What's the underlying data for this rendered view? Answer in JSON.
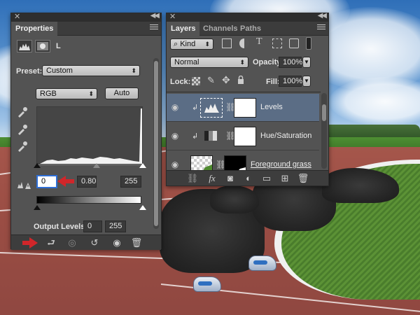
{
  "properties_panel": {
    "tab_label": "Properties",
    "preset_label": "Preset:",
    "preset_value": "Custom",
    "channel_value": "RGB",
    "auto_label": "Auto",
    "input_black": "0",
    "input_gamma": "0.80",
    "input_white": "255",
    "output_levels_label": "Output Levels:",
    "output_black": "0",
    "output_white": "255",
    "mask_indicator": "L"
  },
  "layers_panel": {
    "tabs": [
      {
        "label": "Layers",
        "active": true
      },
      {
        "label": "Channels",
        "active": false
      },
      {
        "label": "Paths",
        "active": false
      }
    ],
    "filter_kind": "Kind",
    "blend_mode": "Normal",
    "opacity_label": "Opacity:",
    "opacity_value": "100%",
    "lock_label": "Lock:",
    "fill_label": "Fill:",
    "fill_value": "100%",
    "layers": [
      {
        "name": "Levels",
        "selected": true
      },
      {
        "name": "Hue/Saturation",
        "selected": false
      },
      {
        "name": "Foreground grass",
        "selected": false
      }
    ]
  },
  "colors": {
    "panel_bg": "#535353",
    "selected_row": "#5b6d85",
    "focus_ring": "#2f6fd6",
    "arrow_red": "#d0262a"
  }
}
